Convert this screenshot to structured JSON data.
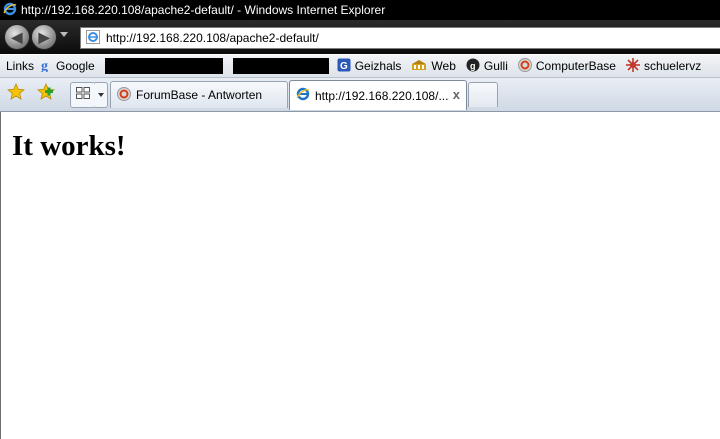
{
  "window": {
    "title": "http://192.168.220.108/apache2-default/ - Windows Internet Explorer",
    "icon": "ie-icon"
  },
  "navigation": {
    "back": "back-button",
    "forward": "forward-button",
    "address": "http://192.168.220.108/apache2-default/"
  },
  "links_bar": {
    "label": "Links",
    "items": [
      {
        "label": "Google",
        "icon": "google-icon"
      },
      {
        "label": "Geizhals",
        "icon": "geizhals-icon"
      },
      {
        "label": "Web",
        "icon": "web-icon"
      },
      {
        "label": "Gulli",
        "icon": "gulli-icon"
      },
      {
        "label": "ComputerBase",
        "icon": "computerbase-icon"
      },
      {
        "label": "schuelervz",
        "icon": "schuelervz-icon"
      }
    ]
  },
  "tabs": [
    {
      "label": "ForumBase - Antworten",
      "icon": "forumbase-icon",
      "active": false
    },
    {
      "label": "http://192.168.220.108/...",
      "icon": "ie-icon",
      "active": true,
      "close": "x"
    }
  ],
  "page": {
    "heading": "It works!"
  },
  "colors": {
    "titlebar": "#000000",
    "ie_blue": "#1e73c8",
    "page_bg": "#ffffff"
  }
}
